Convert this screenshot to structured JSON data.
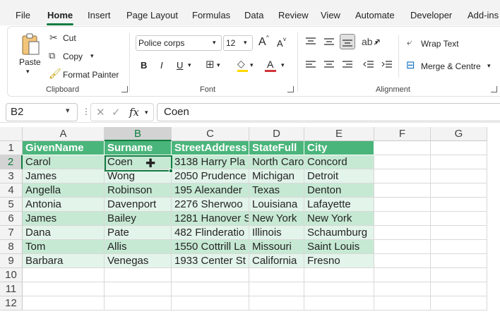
{
  "menu": {
    "tabs": [
      "File",
      "Home",
      "Insert",
      "Page Layout",
      "Formulas",
      "Data",
      "Review",
      "View",
      "Automate",
      "Developer",
      "Add-ins"
    ],
    "active": "Home"
  },
  "ribbon": {
    "clipboard": {
      "paste": "Paste",
      "cut": "Cut",
      "copy": "Copy",
      "format_painter": "Format Painter",
      "label": "Clipboard"
    },
    "font": {
      "name": "Police corps",
      "size": "12",
      "grow": "A",
      "shrink": "A",
      "bold": "B",
      "italic": "I",
      "underline": "U",
      "font_color_glyph": "A",
      "label": "Font",
      "fill_color": "#ffd800",
      "text_color": "#d13438"
    },
    "alignment": {
      "wrap_text": "Wrap Text",
      "merge_centre": "Merge & Centre",
      "label": "Alignment"
    }
  },
  "formula_bar": {
    "name_box": "B2",
    "fx": "fx",
    "value": "Coen"
  },
  "sheet": {
    "columns": [
      "A",
      "B",
      "C",
      "D",
      "E",
      "F",
      "G"
    ],
    "rows": [
      "1",
      "2",
      "3",
      "4",
      "5",
      "6",
      "7",
      "8",
      "9",
      "10",
      "11",
      "12"
    ],
    "selected_cell": "B2",
    "header_fill": "#4ab57b",
    "band_fill_1": "#c6e9d3",
    "band_fill_2": "#e3f4ea",
    "accent": "#107c41",
    "table": {
      "headers": [
        "GivenName",
        "Surname",
        "StreetAddress",
        "StateFull",
        "City"
      ],
      "rows": [
        [
          "Carol",
          "Coen",
          "3138 Harry Pla",
          "North Caro",
          "Concord"
        ],
        [
          "James",
          "Wong",
          "2050 Prudence",
          "Michigan",
          "Detroit"
        ],
        [
          "Angella",
          "Robinson",
          "195 Alexander",
          "Texas",
          "Denton"
        ],
        [
          "Antonia",
          "Davenport",
          "2276 Sherwoo",
          "Louisiana",
          "Lafayette"
        ],
        [
          "James",
          "Bailey",
          "1281 Hanover S",
          "New York",
          "New York"
        ],
        [
          "Dana",
          "Pate",
          "482 Flinderatio",
          "Illinois",
          "Schaumburg"
        ],
        [
          "Tom",
          "Allis",
          "1550 Cottrill La",
          "Missouri",
          "Saint Louis"
        ],
        [
          "Barbara",
          "Venegas",
          "1933 Center St",
          "California",
          "Fresno"
        ]
      ]
    }
  }
}
